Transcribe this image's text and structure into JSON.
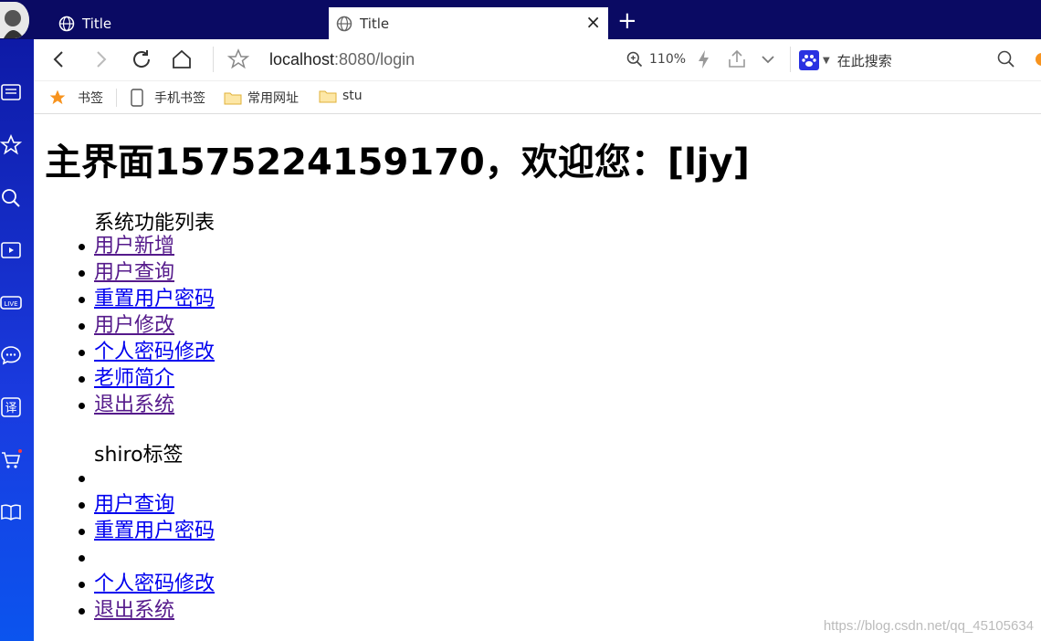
{
  "tabs": [
    {
      "title": "Title"
    },
    {
      "title": "Title"
    }
  ],
  "address": {
    "host": "localhost",
    "rest": ":8080/login"
  },
  "zoom": "110%",
  "search": {
    "placeholder": "在此搜索"
  },
  "bookmarks": [
    "书签",
    "手机书签",
    "常用网址",
    "stu"
  ],
  "page": {
    "heading": "主界面1575224159170，欢迎您：[ljy]",
    "section1": {
      "title": "系统功能列表",
      "items": [
        {
          "label": "用户新增",
          "visited": true
        },
        {
          "label": "用户查询",
          "visited": true
        },
        {
          "label": "重置用户密码",
          "visited": false
        },
        {
          "label": "用户修改",
          "visited": true
        },
        {
          "label": "个人密码修改",
          "visited": false
        },
        {
          "label": "老师简介",
          "visited": false
        },
        {
          "label": "退出系统",
          "visited": true
        }
      ]
    },
    "section2": {
      "title": "shiro标签",
      "items": [
        {
          "label": "",
          "visited": false
        },
        {
          "label": "用户查询",
          "visited": false
        },
        {
          "label": "重置用户密码",
          "visited": false
        },
        {
          "label": "",
          "visited": false
        },
        {
          "label": "个人密码修改",
          "visited": false
        },
        {
          "label": "退出系统",
          "visited": true
        }
      ]
    }
  },
  "watermark": "https://blog.csdn.net/qq_45105634",
  "colors": {
    "link": "#0000ee",
    "visited": "#551a8b",
    "tabbar": "#0a0a63"
  }
}
